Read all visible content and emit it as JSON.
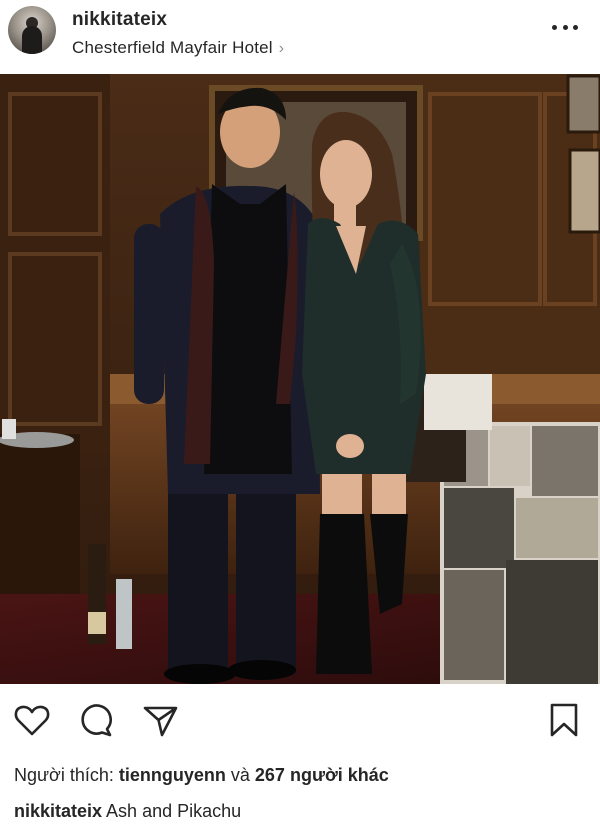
{
  "post": {
    "username": "nikkitateix",
    "location": "Chesterfield Mayfair Hotel",
    "photo_icon": "photo-of-couple",
    "likes": {
      "prefix": "Người thích: ",
      "first_liker": "tiennguyenn",
      "connector": " và ",
      "others_count": "267",
      "suffix_label": " người khác"
    },
    "caption": {
      "username": "nikkitateix",
      "text": " Ash and Pikachu"
    }
  },
  "icons": {
    "more": "more-horizontal-icon",
    "like": "heart-icon",
    "comment": "comment-icon",
    "share": "send-icon",
    "save": "bookmark-icon",
    "location_chevron": "chevron-right-icon"
  },
  "colors": {
    "text": "#262626",
    "secondary": "#8e8e8e",
    "background": "#ffffff"
  }
}
